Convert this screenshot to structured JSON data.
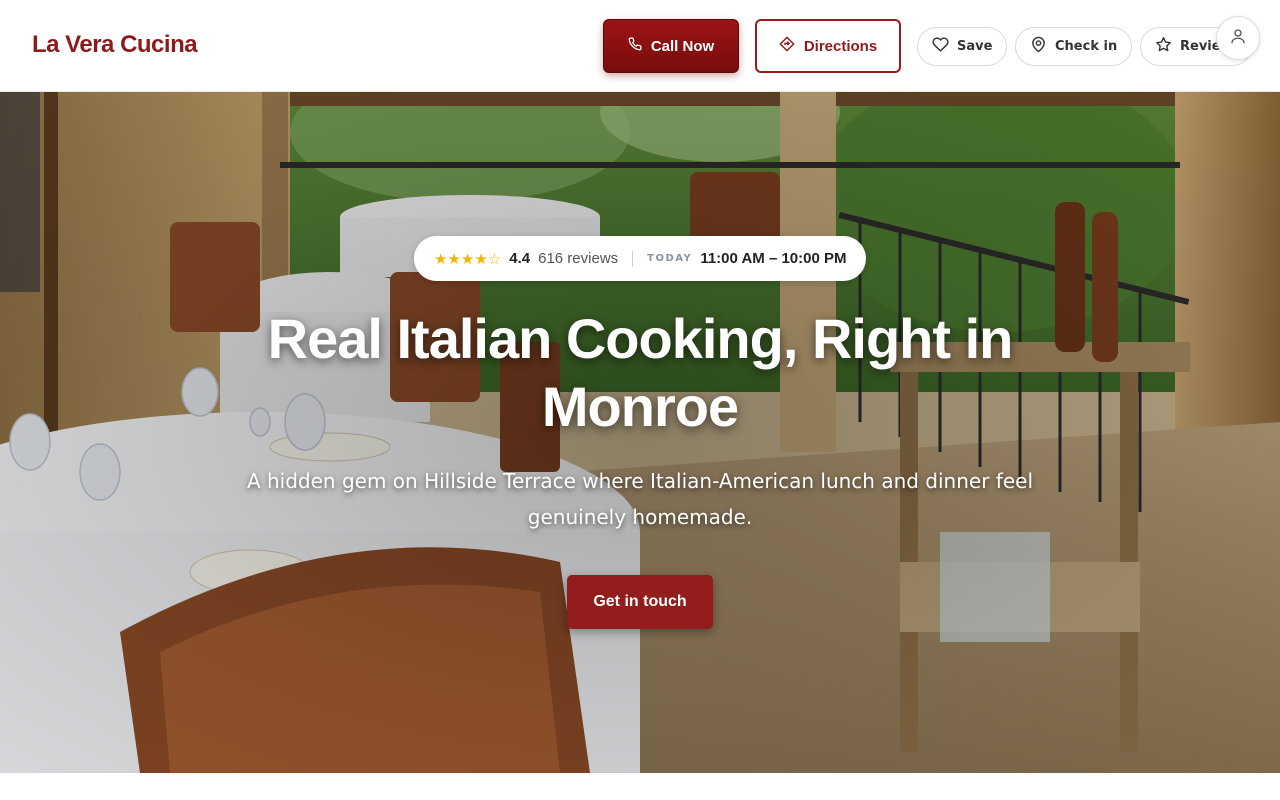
{
  "colors": {
    "brand": "#8e1b1b",
    "call_bg": "#8b1010",
    "cta_bg": "#931d1d",
    "star": "#f2b600"
  },
  "header": {
    "brand": "La Vera Cucina",
    "call_label": "Call Now",
    "call_icon": "phone-icon",
    "directions_label": "Directions",
    "directions_icon": "directions-icon",
    "actions": [
      {
        "label": "Save",
        "icon": "heart-icon"
      },
      {
        "label": "Check in",
        "icon": "map-pin-icon"
      },
      {
        "label": "Review",
        "icon": "star-icon"
      }
    ],
    "avatar_icon": "user-icon"
  },
  "hero": {
    "image": "restaurant-terrace-photo",
    "rating_stars": "★★★★☆",
    "rating_value": 4.4,
    "rating": "4.4",
    "reviews": "616 reviews",
    "today_label": "TODAY",
    "hours": "11:00 AM – 10:00 PM",
    "headline": "Real Italian Cooking, Right in Monroe",
    "subhead": "A hidden gem on Hillside Terrace where Italian-American lunch and dinner feel genuinely homemade.",
    "cta_label": "Get in touch"
  }
}
